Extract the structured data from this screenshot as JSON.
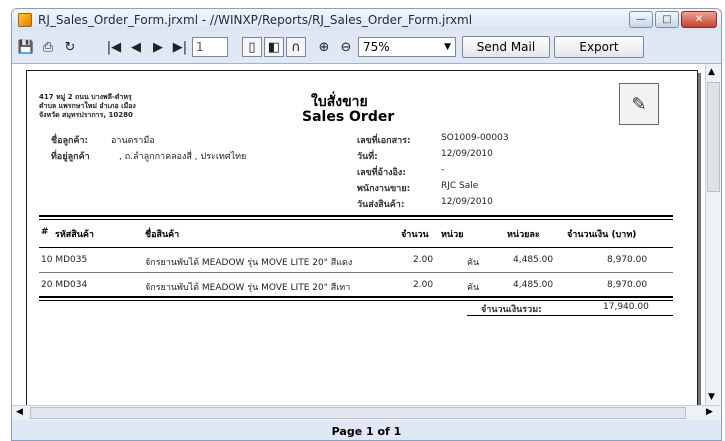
{
  "window": {
    "title": "RJ_Sales_Order_Form.jrxml - //WINXP/Reports/RJ_Sales_Order_Form.jrxml"
  },
  "toolbar": {
    "page_number": "1",
    "zoom": "75%",
    "send_mail_label": "Send Mail",
    "export_label": "Export"
  },
  "report": {
    "company_address": [
      "417 หมู่ 2 ถนน บางพลี-ตำหรุ",
      "ตำบล แพรกษาใหม่ อำเภอ เมือง",
      "จังหวัด สมุทรปราการ, 10280"
    ],
    "title_th": "ใบสั่งขาย",
    "title_en": "Sales Order",
    "customer_label": "ชื่อลูกค้า:",
    "customer_value": "อานดรามือ",
    "address_label": "ที่อยู่ลูกค้า",
    "address_value": ", ถ.ลำลูกกาคลองสี่ , ประเทศไทย",
    "doc_no_label": "เลขที่เอกสาร:",
    "doc_no_value": "SO1009-00003",
    "date_label": "วันที่:",
    "date_value": "12/09/2010",
    "ref_label": "เลขที่อ้างอิง:",
    "ref_value": "-",
    "salesperson_label": "พนักงานขาย:",
    "salesperson_value": "RJC Sale",
    "delivery_label": "วันส่งสินค้า:",
    "delivery_value": "12/09/2010",
    "columns": {
      "no": "#",
      "code": "รหัสสินค้า",
      "name": "ชื่อสินค้า",
      "qty": "จำนวน",
      "unit": "หน่วย",
      "price": "หน่วยละ",
      "amount": "จำนวนเงิน (บาท)"
    },
    "rows": [
      {
        "no_code": "10 MD035",
        "name": "จักรยานพับได้ MEADOW รุ่น MOVE LITE 20\" สีแดง",
        "qty": "2.00",
        "unit": "คัน",
        "price": "4,485.00",
        "amount": "8,970.00"
      },
      {
        "no_code": "20 MD034",
        "name": "จักรยานพับได้ MEADOW รุ่น MOVE LITE 20\" สีเทา",
        "qty": "2.00",
        "unit": "คัน",
        "price": "4,485.00",
        "amount": "8,970.00"
      }
    ],
    "total_label": "จำนวนเงินรวม:",
    "total_value": "17,940.00"
  },
  "status": {
    "page_info": "Page 1 of 1"
  }
}
